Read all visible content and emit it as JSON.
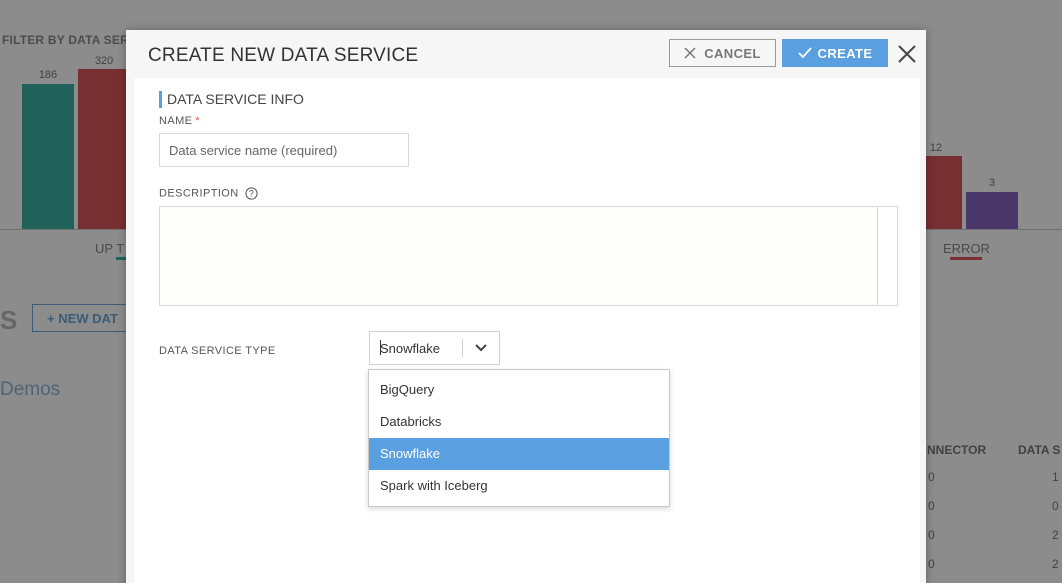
{
  "background": {
    "filter_label": "FILTER BY DATA SER",
    "bars": [
      {
        "value": "186",
        "color": "#3bb3a3"
      },
      {
        "value": "320",
        "color": "#d9575a"
      },
      {
        "value": "12",
        "color": "#d9575a"
      },
      {
        "value": "3",
        "color": "#8966c2"
      }
    ],
    "x_labels": {
      "up": "UP T",
      "error": "ERROR"
    },
    "section_heading": "S",
    "new_button": "+ NEW DAT",
    "demos_label": "Demos",
    "column_headers": {
      "connector": "NNECTOR",
      "data": "DATA S"
    },
    "rows": [
      {
        "connector": "0",
        "data": "1"
      },
      {
        "connector": "0",
        "data": "0"
      },
      {
        "connector": "0",
        "data": "2"
      },
      {
        "connector": "0",
        "data": "2"
      }
    ]
  },
  "modal": {
    "title": "CREATE NEW DATA SERVICE",
    "cancel_label": "CANCEL",
    "create_label": "CREATE",
    "section_title": "DATA SERVICE INFO",
    "name_label": "NAME",
    "name_required_mark": "*",
    "name_placeholder": "Data service name (required)",
    "description_label": "DESCRIPTION",
    "description_value": "",
    "type_label": "DATA SERVICE TYPE",
    "type_selected": "Snowflake",
    "type_options": [
      "BigQuery",
      "Databricks",
      "Snowflake",
      "Spark with Iceberg"
    ],
    "selected_index": 2,
    "accent_color": "#5aa0e1"
  }
}
